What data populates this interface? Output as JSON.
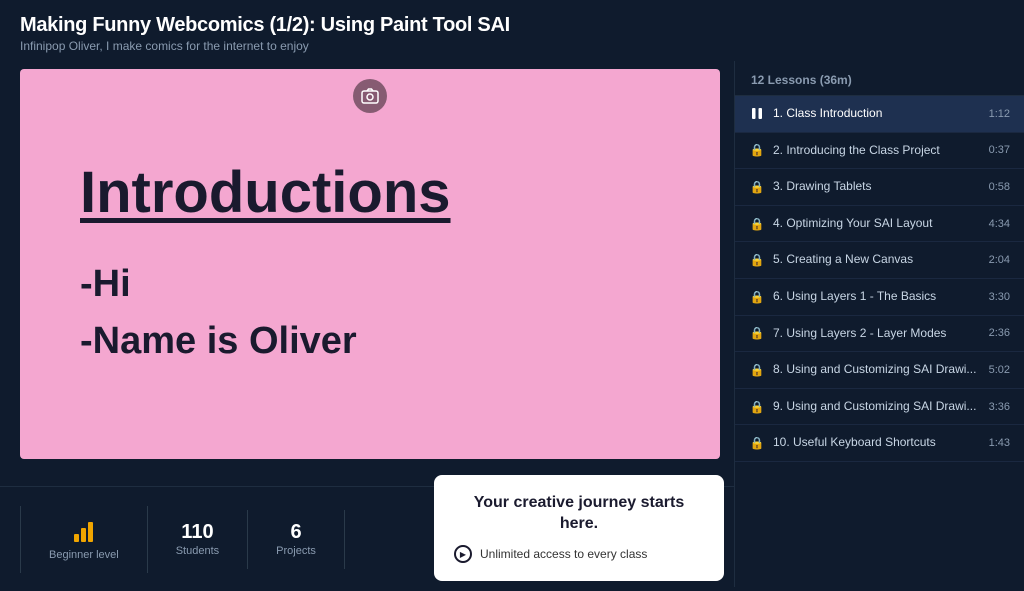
{
  "header": {
    "title": "Making Funny Webcomics (1/2): Using Paint Tool SAI",
    "subtitle": "Infinipop Oliver, I make comics for the internet to enjoy"
  },
  "video": {
    "slide_title": "Introductions",
    "slide_lines": [
      "-Hi",
      "-Name is Oliver"
    ],
    "screenshot_icon": "📷"
  },
  "sidebar": {
    "header": "12 Lessons (36m)",
    "lessons": [
      {
        "id": 1,
        "title": "1. Class Introduction",
        "duration": "1:12",
        "active": true,
        "playing": true,
        "locked": false
      },
      {
        "id": 2,
        "title": "2. Introducing the Class Project",
        "duration": "0:37",
        "active": false,
        "playing": false,
        "locked": true
      },
      {
        "id": 3,
        "title": "3. Drawing Tablets",
        "duration": "0:58",
        "active": false,
        "playing": false,
        "locked": true
      },
      {
        "id": 4,
        "title": "4. Optimizing Your SAI Layout",
        "duration": "4:34",
        "active": false,
        "playing": false,
        "locked": true
      },
      {
        "id": 5,
        "title": "5. Creating a New Canvas",
        "duration": "2:04",
        "active": false,
        "playing": false,
        "locked": true
      },
      {
        "id": 6,
        "title": "6. Using Layers 1 - The Basics",
        "duration": "3:30",
        "active": false,
        "playing": false,
        "locked": true
      },
      {
        "id": 7,
        "title": "7. Using Layers 2 - Layer Modes",
        "duration": "2:36",
        "active": false,
        "playing": false,
        "locked": true
      },
      {
        "id": 8,
        "title": "8. Using and Customizing SAI Drawi...",
        "duration": "5:02",
        "active": false,
        "playing": false,
        "locked": true
      },
      {
        "id": 9,
        "title": "9. Using and Customizing SAI Drawi...",
        "duration": "3:36",
        "active": false,
        "playing": false,
        "locked": true
      },
      {
        "id": 10,
        "title": "10. Useful Keyboard Shortcuts",
        "duration": "1:43",
        "active": false,
        "playing": false,
        "locked": true
      }
    ]
  },
  "stats": [
    {
      "icon": "bar_chart",
      "value": "",
      "label": "Beginner level"
    },
    {
      "value": "110",
      "label": "Students"
    },
    {
      "value": "6",
      "label": "Projects"
    }
  ],
  "cta": {
    "title": "Your creative journey starts here.",
    "feature": "Unlimited access to every class"
  }
}
